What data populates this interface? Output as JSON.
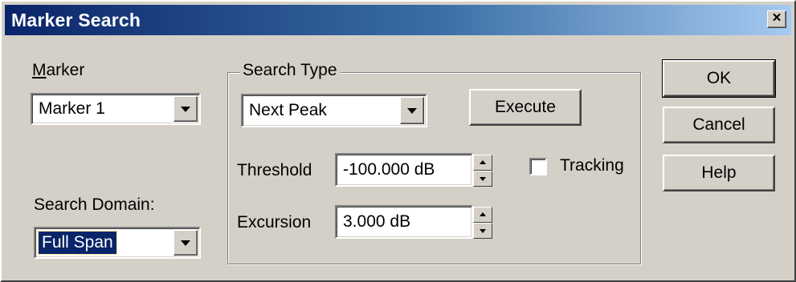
{
  "window": {
    "title": "Marker Search",
    "close_glyph": "×"
  },
  "marker": {
    "label": "Marker",
    "label_accel": "M",
    "label_rest": "arker",
    "selected": "Marker 1"
  },
  "search_domain": {
    "label": "Search Domain:",
    "selected": "Full Span"
  },
  "search_type": {
    "group_label": "Search Type",
    "selected": "Next Peak",
    "execute_label": "Execute",
    "threshold_label": "Threshold",
    "threshold_value": "-100.000 dB",
    "excursion_label": "Excursion",
    "excursion_value": "3.000 dB",
    "tracking_label": "Tracking",
    "tracking_checked": false
  },
  "buttons": {
    "ok": "OK",
    "cancel": "Cancel",
    "help": "Help"
  },
  "icons": {
    "close": "close-icon",
    "dropdown": "chevron-down-icon",
    "spin_up": "spin-up-icon",
    "spin_down": "spin-down-icon"
  },
  "colors": {
    "titlebar_start": "#0a246a",
    "titlebar_end": "#a6caf0",
    "dialog_bg": "#d4d0c8",
    "selection": "#0a246a"
  }
}
